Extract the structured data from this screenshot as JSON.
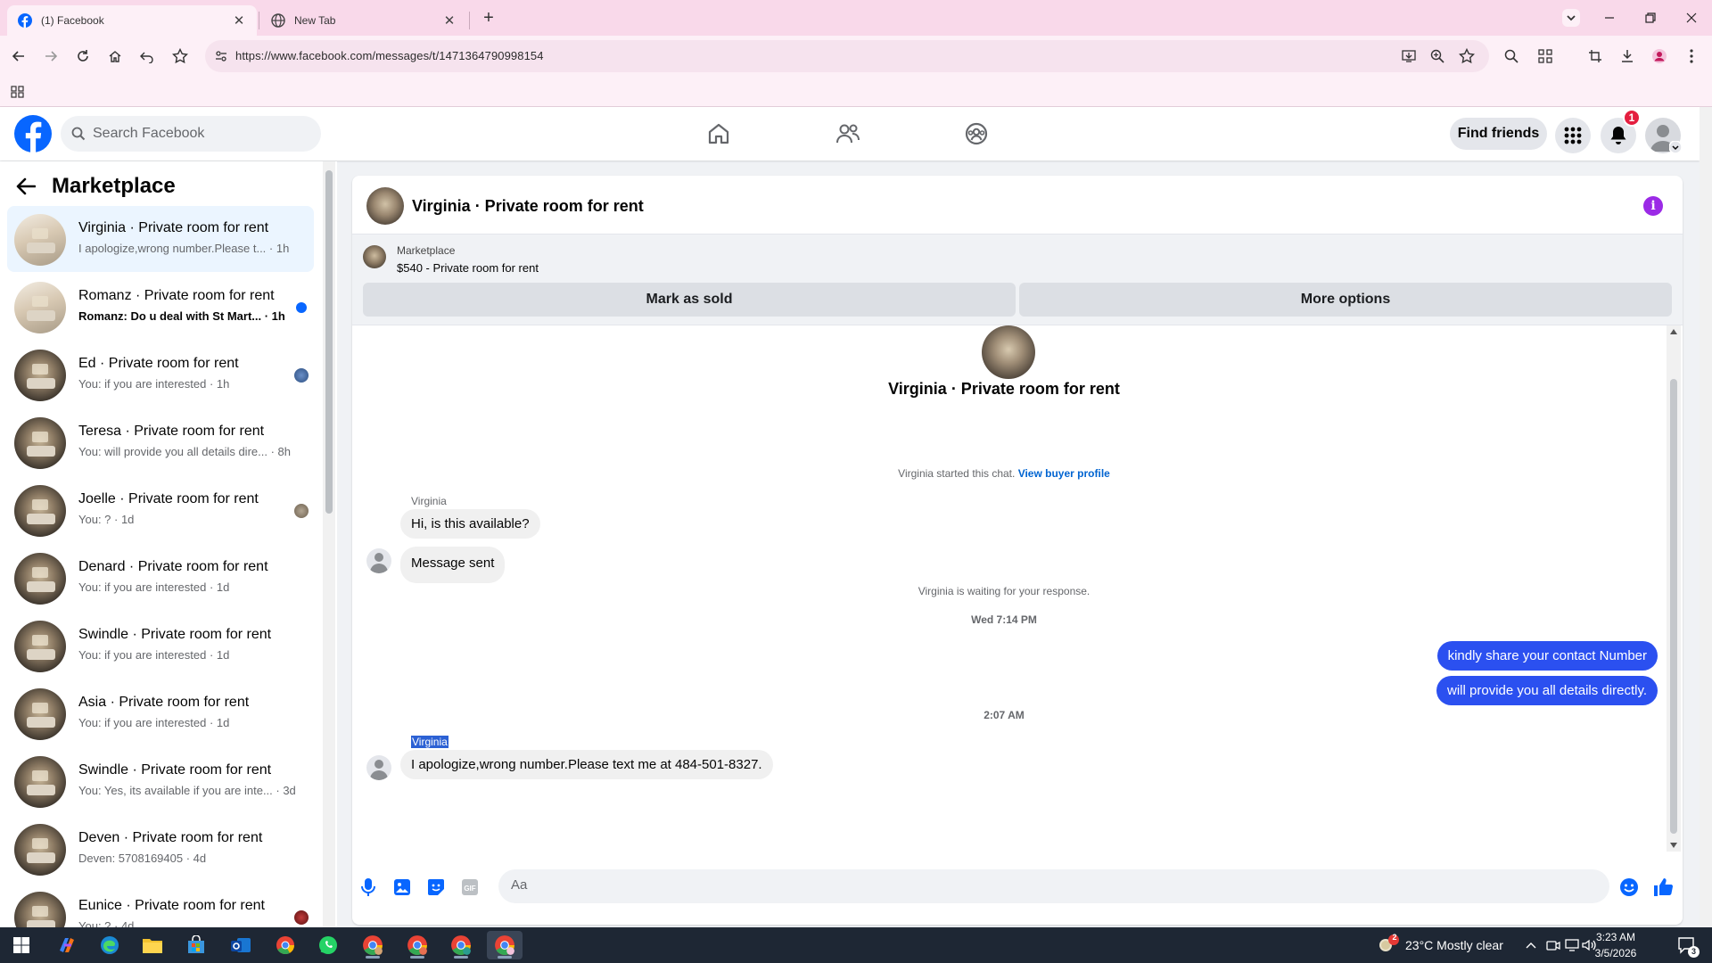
{
  "browser": {
    "tabs": [
      {
        "title": "(1) Facebook",
        "active": true
      },
      {
        "title": "New Tab",
        "active": false
      }
    ],
    "url": "https://www.facebook.com/messages/t/1471364790998154"
  },
  "fb": {
    "search_placeholder": "Search Facebook",
    "find_friends": "Find friends",
    "notification_count": "1"
  },
  "sidebar": {
    "title": "Marketplace",
    "conversations": [
      {
        "name": "Virginia · Private room for rent",
        "snippet": "I apologize,wrong number.Please t... · 1h",
        "active": true
      },
      {
        "name": "Romanz · Private room for rent",
        "snippet": "Romanz: Do u deal with St Mart... · 1h",
        "unread": true
      },
      {
        "name": "Ed · Private room for rent",
        "snippet": "You: if you are interested · 1h"
      },
      {
        "name": "Teresa · Private room for rent",
        "snippet": "You: will provide you all details dire... · 8h"
      },
      {
        "name": "Joelle · Private room for rent",
        "snippet": "You: ? · 1d"
      },
      {
        "name": "Denard · Private room for rent",
        "snippet": "You: if you are interested · 1d"
      },
      {
        "name": "Swindle · Private room for rent",
        "snippet": "You: if you are interested · 1d"
      },
      {
        "name": "Asia · Private room for rent",
        "snippet": "You: if you are interested · 1d"
      },
      {
        "name": "Swindle · Private room for rent",
        "snippet": "You: Yes, its available if you are inte... · 3d"
      },
      {
        "name": "Deven · Private room for rent",
        "snippet": "Deven: 5708169405 · 4d"
      },
      {
        "name": "Eunice · Private room for rent",
        "snippet": "You: ? · 4d"
      }
    ]
  },
  "chat": {
    "title": "Virginia · Private room for rent",
    "listing": {
      "source": "Marketplace",
      "price_title": "$540 - Private room for rent",
      "mark_sold": "Mark as sold",
      "more_options": "More options"
    },
    "intro_title": "Virginia · Private room for rent",
    "started_text": "Virginia started this chat.",
    "view_buyer_profile": "View buyer profile",
    "sender_1": "Virginia",
    "msg_in_1": "Hi, is this available?",
    "msg_in_2": "Message sent",
    "waiting": "Virginia is waiting for your response.",
    "ts_1": "Wed 7:14 PM",
    "msg_out_1": "kindly share your contact Number",
    "msg_out_2": "will provide you all details directly.",
    "ts_2": "2:07 AM",
    "sender_2": "Virginia",
    "msg_in_3": "I  apologize,wrong number.Please text me at 484-501-8327.",
    "composer_placeholder": "Aa"
  },
  "taskbar": {
    "weather": "23°C  Mostly clear",
    "weather_badge": "2",
    "time": "3:23 AM",
    "date": "3/5/2026",
    "notif_count": "3"
  },
  "colors": {
    "fb_blue": "#0866ff",
    "outgoing_bubble": "#2b50f0",
    "badge_red": "#e41e3f",
    "info_purple": "#9b2ae6",
    "tabstrip_pink": "#f9d9ea"
  }
}
